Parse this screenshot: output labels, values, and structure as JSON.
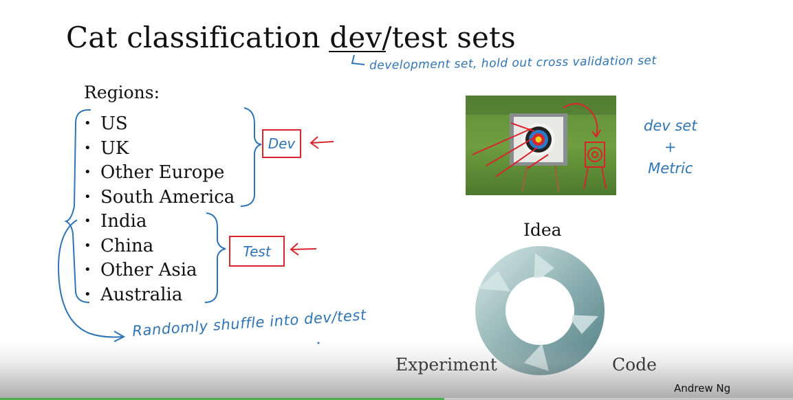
{
  "slide": {
    "title": "Cat classification dev/test sets",
    "regions_label": "Regions:",
    "bullet": "•",
    "regions": [
      "US",
      "UK",
      "Other Europe",
      "South America",
      "India",
      "China",
      "Other Asia",
      "Australia"
    ],
    "cycle": {
      "idea": "Idea",
      "code": "Code",
      "experiment": "Experiment"
    },
    "author": "Andrew Ng"
  },
  "annotations": {
    "dev_definition": "development set, hold out cross validation set",
    "dev_box": "Dev",
    "test_box": "Test",
    "shuffle_note": "Randomly shuffle into dev/test",
    "devset_note_line1": "dev set",
    "devset_note_line2": "+",
    "devset_note_line3": "Metric"
  },
  "video": {
    "progress": 0.56
  },
  "colors": {
    "pen_blue": "#2f74b4",
    "pen_red": "#d8242b",
    "progress": "#4caf50"
  }
}
